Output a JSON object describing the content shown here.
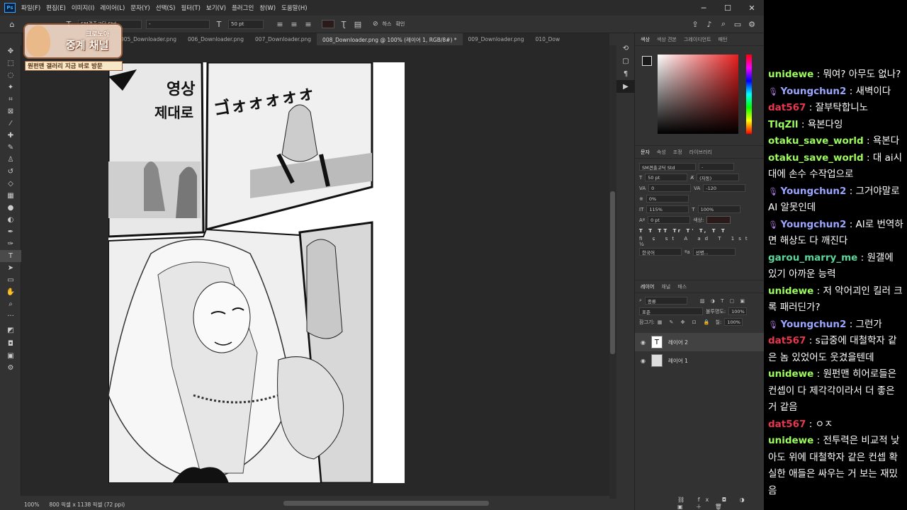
{
  "menu": [
    "파일(F)",
    "편집(E)",
    "이미지(I)",
    "레이어(L)",
    "문자(Y)",
    "선택(S)",
    "필터(T)",
    "보기(V)",
    "플러그인",
    "창(W)",
    "도움말(H)"
  ],
  "app_logo": "Ps",
  "options": {
    "font_family": "SM견출고딕 Std",
    "font_style": "-",
    "font_size": "50 pt",
    "color_label": "",
    "aa_label": "하스",
    "hint": "확인"
  },
  "tabs": [
    "005_Downloader.png",
    "006_Downloader.png",
    "007_Downloader.png",
    "008_Downloader.png @ 100% (레이어 1, RGB/8#) *",
    "009_Downloader.png",
    "010_Dow"
  ],
  "overlay": {
    "top_label": "크로노아",
    "title": "중계 채널",
    "banner": "원펀맨 갤러리 지금 바로 방문"
  },
  "status": {
    "zoom": "100%",
    "info": "800 픽셀 x 1138 픽셀 (72 ppi)"
  },
  "manga": {
    "sfx1": "영상",
    "sfx2": "제대로",
    "sfx3": "ゴォォォォォ"
  },
  "color_panel": {
    "tabs": [
      "색상",
      "색상 견본",
      "그레이디언트",
      "패턴"
    ]
  },
  "char_panel": {
    "tabs": [
      "문자",
      "속성",
      "조정",
      "라이브러리"
    ],
    "font": "SM견출고딕 Std",
    "style": "-",
    "size": "50 pt",
    "leading": "(자동)",
    "kerning": "0",
    "tracking": "-120",
    "vscale_pct": "0%",
    "vscale": "115%",
    "hscale": "100%",
    "baseline": "0 pt",
    "color_label": "색상:",
    "lang": "한국어",
    "sharp": "선명...",
    "glyphs": "T T TT Tr T' T, T T"
  },
  "layers_panel": {
    "tabs": [
      "레이어",
      "채널",
      "패스"
    ],
    "filter": "종류",
    "blend": "표준",
    "opacity_label": "불투명도:",
    "opacity": "100%",
    "fill_label": "칠:",
    "fill": "100%",
    "lock_label": "잠그기:",
    "layers": [
      "레이어 2",
      "레이어 1"
    ]
  },
  "chat": [
    {
      "user": "unidewe",
      "color": "#9bfb5c",
      "mic": false,
      "text": "뭐여? 아무도 없나?"
    },
    {
      "user": "Youngchun2",
      "color": "#9aa6ff",
      "mic": true,
      "text": "새벽이다"
    },
    {
      "user": "dat567",
      "color": "#e8364f",
      "mic": false,
      "text": "잘부탁합니노"
    },
    {
      "user": "TlqZll",
      "color": "#9bfb5c",
      "mic": false,
      "text": "욕본다잉"
    },
    {
      "user": "otaku_save_world",
      "color": "#9bfb5c",
      "mic": false,
      "text": "욕본다"
    },
    {
      "user": "otaku_save_world",
      "color": "#9bfb5c",
      "mic": false,
      "text": "대 ai시대에 손수 수작업으로"
    },
    {
      "user": "Youngchun2",
      "color": "#9aa6ff",
      "mic": true,
      "text": "그거야말로 AI 알못인데"
    },
    {
      "user": "Youngchun2",
      "color": "#9aa6ff",
      "mic": true,
      "text": "AI로 번역하면 해상도 다 깨진다"
    },
    {
      "user": "garou_marry_me",
      "color": "#5cd69b",
      "mic": false,
      "text": "원갤에 있기 아까운 능력"
    },
    {
      "user": "unidewe",
      "color": "#9bfb5c",
      "mic": false,
      "text": "저 악어괴인 킬러 크록 패러딘가?"
    },
    {
      "user": "Youngchun2",
      "color": "#9aa6ff",
      "mic": true,
      "text": "그런가"
    },
    {
      "user": "dat567",
      "color": "#e8364f",
      "mic": false,
      "text": "s급중에 대철학자 같은 놈 있었어도 웃겼을텐데"
    },
    {
      "user": "unidewe",
      "color": "#9bfb5c",
      "mic": false,
      "text": "원펀맨 히어로들은 컨셉이 다 제각각이라서 더 좋은 거 같음"
    },
    {
      "user": "dat567",
      "color": "#e8364f",
      "mic": false,
      "text": "ㅇㅈ"
    },
    {
      "user": "unidewe",
      "color": "#9bfb5c",
      "mic": false,
      "text": "전투력은 비교적 낮아도 위에 대철학자 같은 컨셉 확실한 애들은 싸우는 거 보는 재밌음"
    }
  ]
}
